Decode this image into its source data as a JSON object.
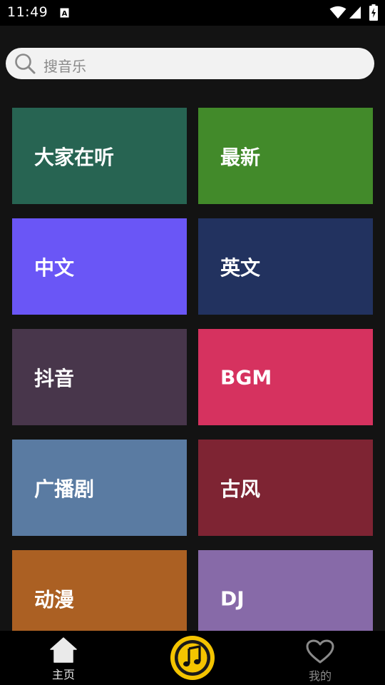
{
  "status_bar": {
    "time": "11:49",
    "notification_icon": "a-notification-icon",
    "wifi_icon": "wifi-icon",
    "signal_icon": "signal-icon",
    "battery_icon": "battery-charging-icon"
  },
  "search": {
    "placeholder": "搜音乐",
    "icon": "search-icon"
  },
  "categories": [
    {
      "label": "大家在听",
      "color": "#276452"
    },
    {
      "label": "最新",
      "color": "#428a2a"
    },
    {
      "label": "中文",
      "color": "#6a56f6"
    },
    {
      "label": "英文",
      "color": "#22325f"
    },
    {
      "label": "抖音",
      "color": "#48364b"
    },
    {
      "label": "BGM",
      "color": "#d6325f"
    },
    {
      "label": "广播剧",
      "color": "#5a7ba2"
    },
    {
      "label": "古风",
      "color": "#7e2433"
    },
    {
      "label": "动漫",
      "color": "#ab6023"
    },
    {
      "label": "DJ",
      "color": "#876aa8"
    }
  ],
  "bottom_nav": {
    "home_label": "主页",
    "home_icon": "home-icon",
    "player_icon": "music-note-icon",
    "mine_label": "我的",
    "mine_icon": "heart-icon",
    "accent_color": "#f4c400"
  }
}
